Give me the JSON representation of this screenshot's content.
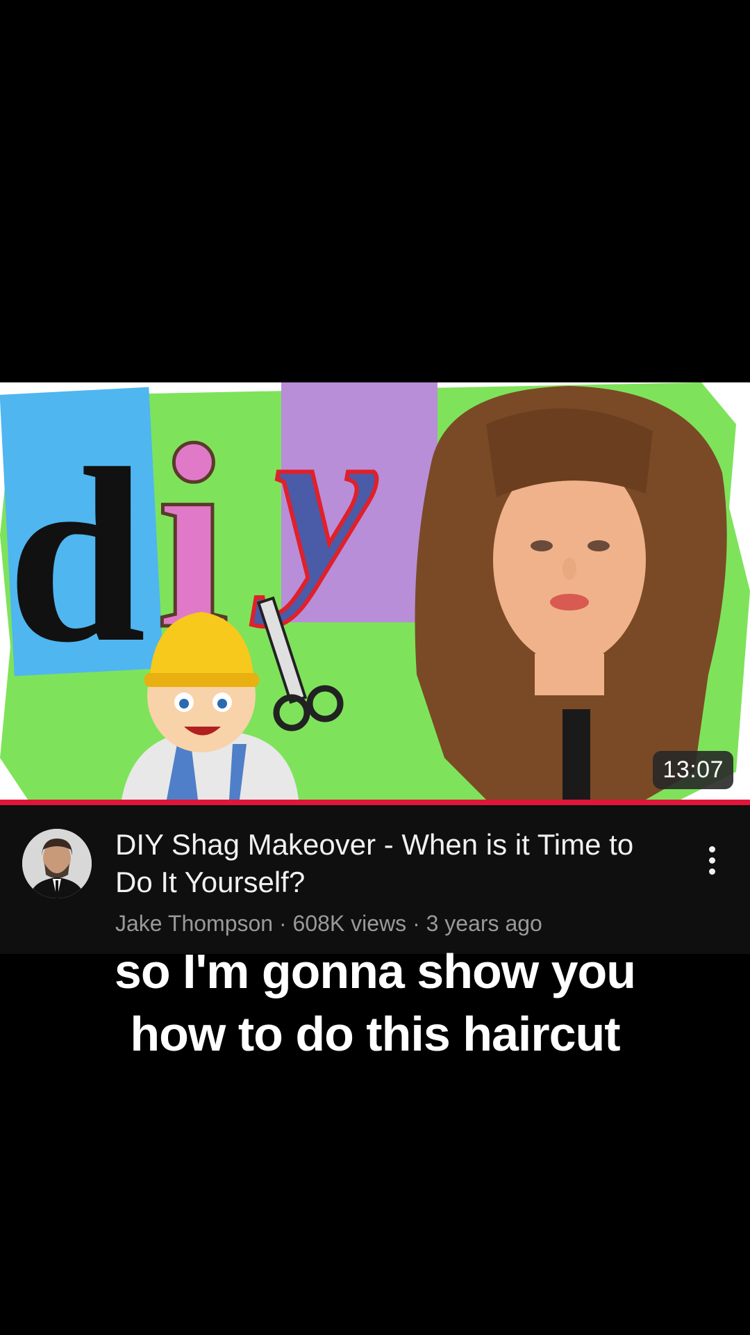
{
  "video": {
    "duration": "13:07",
    "progress_fraction": 1.0,
    "title": "DIY Shag Makeover - When is it Time to Do It Yourself?",
    "channel": "Jake Thompson",
    "views": "608K views",
    "age": "3 years ago",
    "meta_separator": " · ",
    "menu_icon": "more-vertical-icon",
    "thumbnail_letters": [
      "d",
      "i",
      "y"
    ]
  },
  "caption": {
    "line1": "so I'm gonna show you",
    "line2": "how to do this haircut"
  },
  "colors": {
    "background": "#000000",
    "panel": "#0f0f0f",
    "progress": "#e0153a",
    "thumbnail_green": "#7ee35b",
    "title_text": "#f1f1f1",
    "meta_text": "#9a9a9a"
  }
}
